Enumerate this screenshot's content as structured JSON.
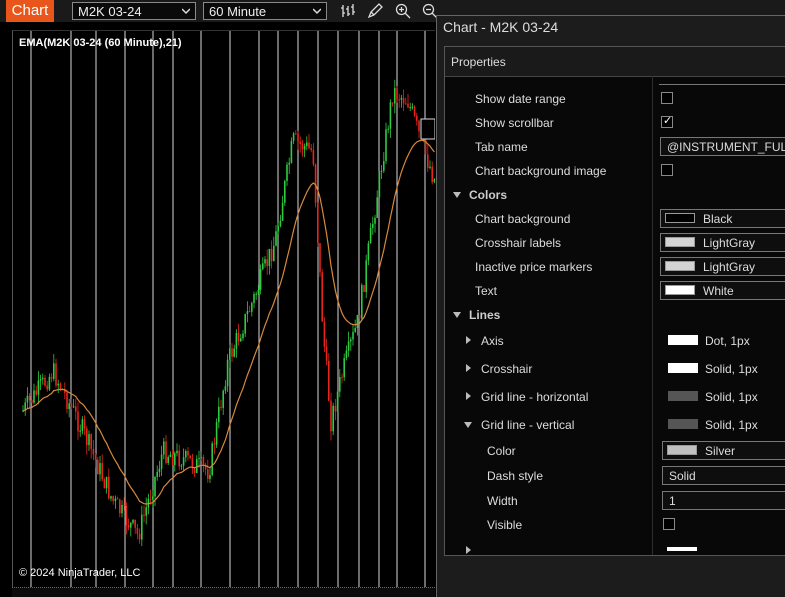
{
  "toolbar": {
    "chart_tab_label": "Chart",
    "instrument": "M2K 03-24",
    "interval": "60 Minute",
    "icons": [
      "bar-type-icon",
      "draw-pencil-icon",
      "zoom-in-icon",
      "zoom-out-icon"
    ]
  },
  "chart": {
    "indicator_label": "EMA(M2K 03-24 (60 Minute),21)",
    "copyright": "© 2024 NinjaTrader, LLC",
    "colors": {
      "up": "#2ecc40",
      "down": "#e8241b",
      "ema": "#d8893a",
      "grid": "#d8d8d8"
    }
  },
  "dialog": {
    "title": "Chart - M2K 03-24",
    "properties_label": "Properties",
    "rows": [
      {
        "label": "Show date range",
        "checked": false
      },
      {
        "label": "Show scrollbar",
        "checked": true
      },
      {
        "label": "Tab name",
        "value": "@INSTRUMENT_FULL"
      },
      {
        "label": "Chart background image",
        "checked": false
      }
    ],
    "colors_category": "Colors",
    "color_rows": [
      {
        "label": "Chart background",
        "value": "Black",
        "swatch": "#000000"
      },
      {
        "label": "Crosshair labels",
        "value": "LightGray",
        "swatch": "#d3d3d3"
      },
      {
        "label": "Inactive price markers",
        "value": "LightGray",
        "swatch": "#d3d3d3"
      },
      {
        "label": "Text",
        "value": "White",
        "swatch": "#ffffff"
      }
    ],
    "lines_category": "Lines",
    "line_rows": [
      {
        "label": "Axis",
        "value": "Dot, 1px",
        "swatch": "#ffffff"
      },
      {
        "label": "Crosshair",
        "value": "Solid, 1px",
        "swatch": "#ffffff"
      },
      {
        "label": "Grid line - horizontal",
        "value": "Solid, 1px",
        "swatch": "#555555"
      },
      {
        "label": "Grid line - vertical",
        "value": "Solid, 1px",
        "swatch": "#555555"
      }
    ],
    "grid_vertical": {
      "color_label": "Color",
      "color_value": "Silver",
      "color_swatch": "#c0c0c0",
      "dash_label": "Dash style",
      "dash_value": "Solid",
      "width_label": "Width",
      "width_value": "1",
      "visible_label": "Visible",
      "visible_checked": false
    }
  }
}
